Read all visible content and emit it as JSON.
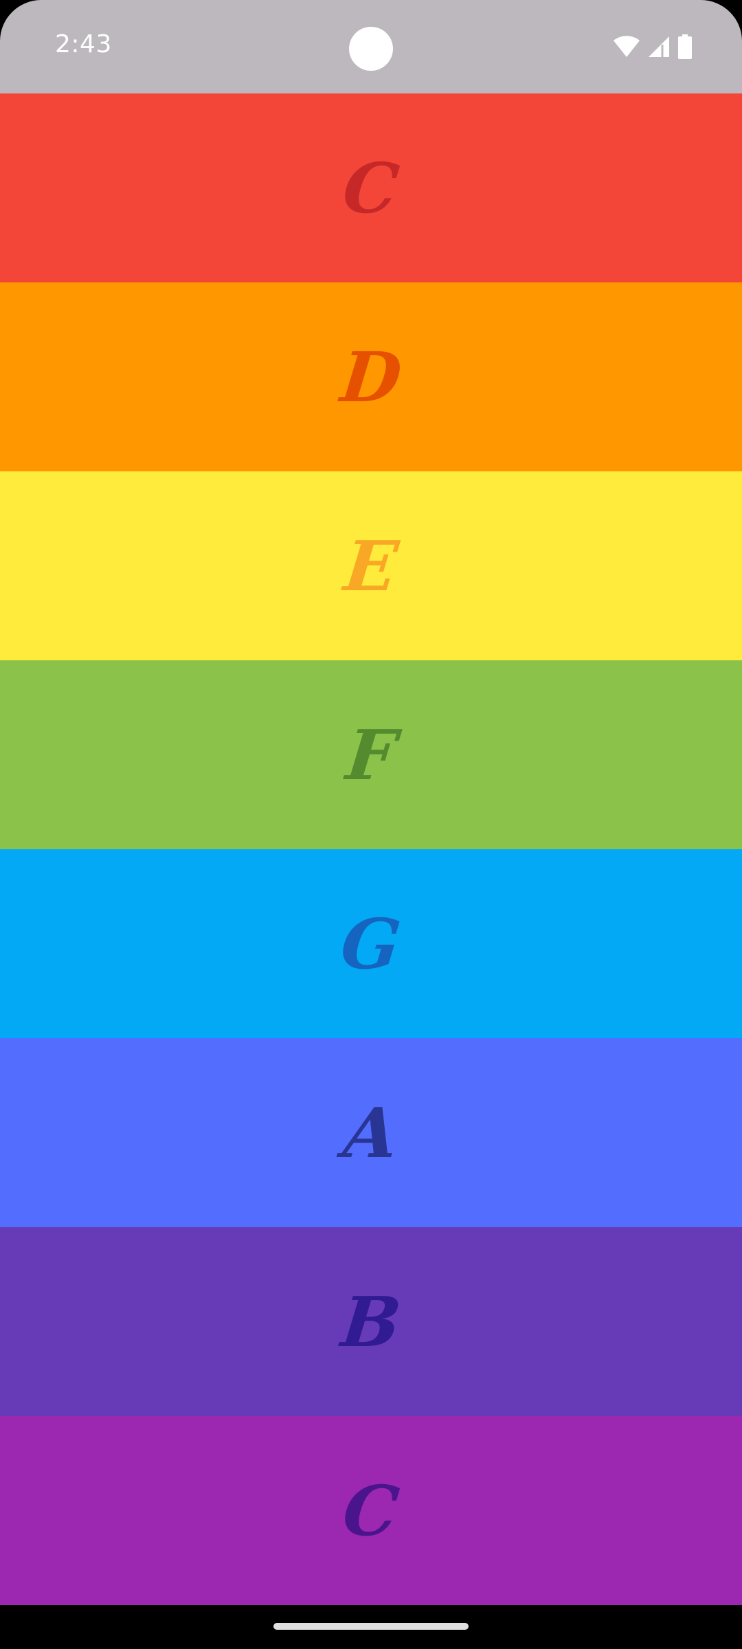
{
  "status_bar": {
    "time": "2:43",
    "icons": [
      "wifi-icon",
      "cellular-signal-icon",
      "battery-icon"
    ],
    "background": "#bdb8bd"
  },
  "bands": [
    {
      "letter": "C",
      "background": "#f44539",
      "letter_color": "#c62828"
    },
    {
      "letter": "D",
      "background": "#ff9800",
      "letter_color": "#e65100"
    },
    {
      "letter": "E",
      "background": "#ffeb3b",
      "letter_color": "#f9a825"
    },
    {
      "letter": "F",
      "background": "#8bc34a",
      "letter_color": "#558b2f"
    },
    {
      "letter": "G",
      "background": "#03a9f4",
      "letter_color": "#1565c0"
    },
    {
      "letter": "A",
      "background": "#536dfe",
      "letter_color": "#283593"
    },
    {
      "letter": "B",
      "background": "#673ab7",
      "letter_color": "#311b92"
    },
    {
      "letter": "C",
      "background": "#9c27b0",
      "letter_color": "#4a148c"
    }
  ]
}
